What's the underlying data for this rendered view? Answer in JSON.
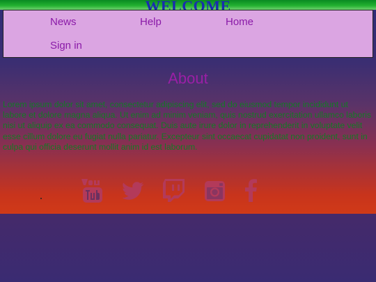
{
  "header": {
    "title": "WELCOME"
  },
  "nav": {
    "items": [
      {
        "label": "News"
      },
      {
        "label": "Help"
      },
      {
        "label": "Home"
      },
      {
        "label": "Sign in"
      }
    ]
  },
  "main": {
    "heading": "About",
    "body": "Lorem ipsum dolor sit amet, consectetur adipiscing elit, sed do eiusmod tempor incididunt ut labore et dolore magna aliqua. Ut enim ad minim veniam, quis nostrud exercitation ullamco laboris nisi ut aliquip ex ea commodo consequat. Duis aute irure dolor in reprehenderit in voluptate velit esse cillum dolore eu fugiat nulla pariatur. Excepteur sint occaecat cupidatat non proident, sunt in culpa qui officia deserunt mollit anim id est laborum."
  },
  "social": {
    "icons": [
      "youtube-icon",
      "twitter-icon",
      "twitch-icon",
      "instagram-icon",
      "facebook-icon"
    ],
    "icon_color": "#b33a5a"
  },
  "colors": {
    "welcome": "#1a2bb0",
    "nav_bg": "#dba5e2",
    "nav_link": "#8a1aa8",
    "heading": "#9b1fa6",
    "body_text": "#127a24"
  }
}
